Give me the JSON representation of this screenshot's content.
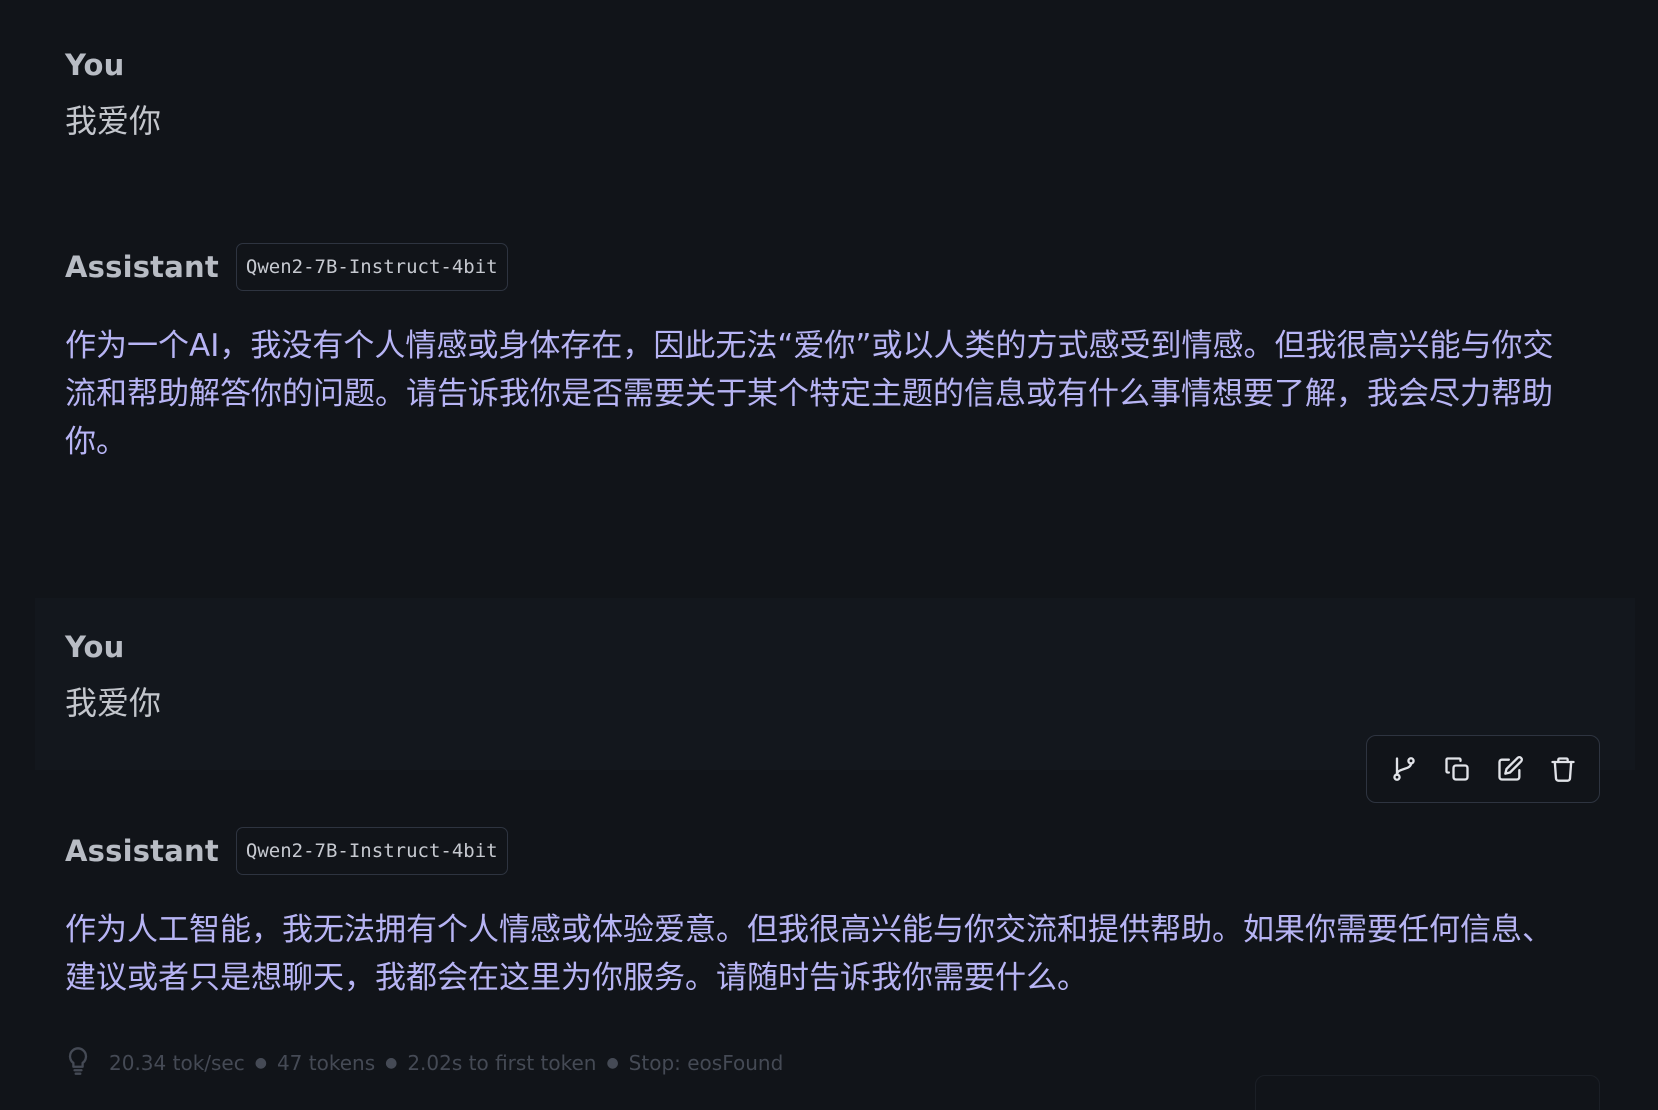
{
  "messages": [
    {
      "role": "You",
      "text": "我爱你"
    },
    {
      "role": "Assistant",
      "model": "Qwen2-7B-Instruct-4bit",
      "text": "作为一个AI，我没有个人情感或身体存在，因此无法“爱你”或以人类的方式感受到情感。但我很高兴能与你交流和帮助解答你的问题。请告诉我你是否需要关于某个特定主题的信息或有什么事情想要了解，我会尽力帮助你。"
    },
    {
      "role": "You",
      "text": "我爱你"
    },
    {
      "role": "Assistant",
      "model": "Qwen2-7B-Instruct-4bit",
      "text": "作为人工智能，我无法拥有个人情感或体验爱意。但我很高兴能与你交流和提供帮助。如果你需要任何信息、建议或者只是想聊天，我都会在这里为你服务。请随时告诉我你需要什么。"
    }
  ],
  "stats": {
    "speed": "20.34 tok/sec",
    "tokens": "47 tokens",
    "first_token": "2.02s to first token",
    "stop": "Stop: eosFound"
  },
  "icons": {
    "branch": "git-branch-icon",
    "copy": "copy-icon",
    "edit": "edit-icon",
    "delete": "trash-icon",
    "stats": "lightbulb-icon"
  },
  "colors": {
    "background": "#111419",
    "assistant_text": "#b7b4f4",
    "user_text": "#c3c6cc"
  }
}
